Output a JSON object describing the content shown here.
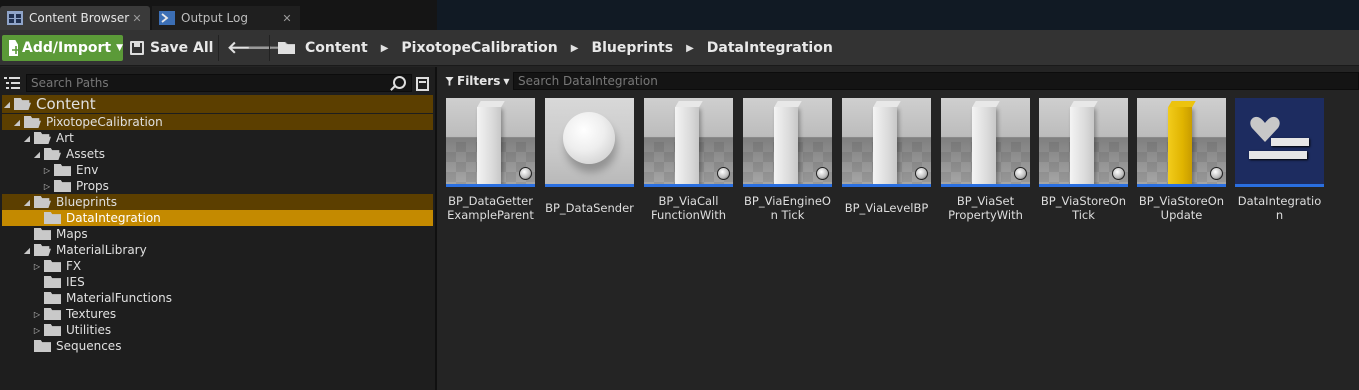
{
  "tabs": [
    {
      "label": "Content Browser",
      "active": true
    },
    {
      "label": "Output Log",
      "active": false
    }
  ],
  "toolbar": {
    "add_import_label": "Add/Import",
    "save_all_label": "Save All",
    "breadcrumbs": [
      "Content",
      "PixotopeCalibration",
      "Blueprints",
      "DataIntegration"
    ]
  },
  "sources": {
    "search_placeholder": "Search Paths",
    "tree": [
      {
        "label": "Content",
        "depth": 0,
        "expanded": true,
        "state": "highlight"
      },
      {
        "label": "PixotopeCalibration",
        "depth": 1,
        "expanded": true,
        "state": "highlight"
      },
      {
        "label": "Art",
        "depth": 2,
        "expanded": true,
        "state": "none"
      },
      {
        "label": "Assets",
        "depth": 3,
        "expanded": true,
        "state": "none"
      },
      {
        "label": "Env",
        "depth": 4,
        "expanded": false,
        "state": "none"
      },
      {
        "label": "Props",
        "depth": 4,
        "expanded": false,
        "state": "none"
      },
      {
        "label": "Blueprints",
        "depth": 2,
        "expanded": true,
        "state": "highlight"
      },
      {
        "label": "DataIntegration",
        "depth": 3,
        "expanded": null,
        "state": "selected"
      },
      {
        "label": "Maps",
        "depth": 2,
        "expanded": null,
        "state": "none"
      },
      {
        "label": "MaterialLibrary",
        "depth": 2,
        "expanded": true,
        "state": "none"
      },
      {
        "label": "FX",
        "depth": 3,
        "expanded": false,
        "state": "none"
      },
      {
        "label": "IES",
        "depth": 3,
        "expanded": null,
        "state": "none"
      },
      {
        "label": "MaterialFunctions",
        "depth": 3,
        "expanded": null,
        "state": "none"
      },
      {
        "label": "Textures",
        "depth": 3,
        "expanded": false,
        "state": "none"
      },
      {
        "label": "Utilities",
        "depth": 3,
        "expanded": false,
        "state": "none"
      },
      {
        "label": "Sequences",
        "depth": 2,
        "expanded": null,
        "state": "none"
      }
    ]
  },
  "assets": {
    "filters_label": "Filters",
    "search_placeholder": "Search DataIntegration",
    "items": [
      {
        "name": "BP_DataGetter ExampleParent",
        "thumbnail": "white-pillar"
      },
      {
        "name": "BP_DataSender",
        "thumbnail": "white-sphere"
      },
      {
        "name": "BP_ViaCall FunctionWith Actor",
        "thumbnail": "white-pillar"
      },
      {
        "name": "BP_ViaEngineOn Tick",
        "thumbnail": "white-pillar"
      },
      {
        "name": "BP_ViaLevelBP",
        "thumbnail": "white-pillar"
      },
      {
        "name": "BP_ViaSet PropertyWith Actor",
        "thumbnail": "white-pillar"
      },
      {
        "name": "BP_ViaStoreOn Tick",
        "thumbnail": "white-pillar"
      },
      {
        "name": "BP_ViaStoreOn Update",
        "thumbnail": "yellow-pillar"
      },
      {
        "name": "DataIntegration OverlayWidget",
        "thumbnail": "widget-blueprint"
      }
    ]
  },
  "colors": {
    "accent_green": "#5b9a38",
    "selection_gold": "#c48a00",
    "highlight_brown": "#5c3f00",
    "asset_underline_blue": "#2a6fe0"
  }
}
